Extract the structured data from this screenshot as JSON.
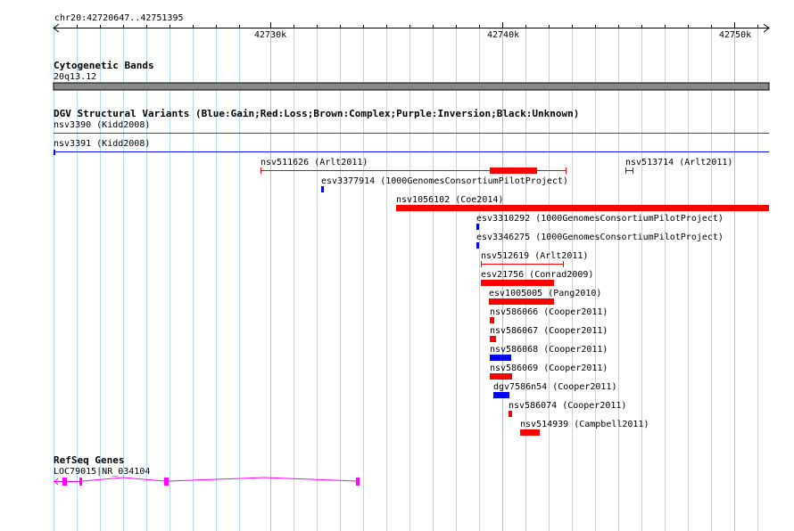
{
  "ruler": {
    "location": "chr20:42720647..42751395",
    "ticks": [
      "42730k",
      "42740k",
      "42750k"
    ]
  },
  "cytoband": {
    "title": "Cytogenetic Bands",
    "band": "20q13.12"
  },
  "dgv": {
    "title": "DGV Structural Variants (Blue:Gain;Red:Loss;Brown:Complex;Purple:Inversion;Black:Unknown)",
    "colors": {
      "gain": "#0000ff",
      "loss": "#ff0000",
      "inversion": "#800080"
    },
    "features": [
      {
        "id": "nsv3390",
        "label": "nsv3390 (Kidd2008)"
      },
      {
        "id": "nsv3391",
        "label": "nsv3391 (Kidd2008)"
      },
      {
        "id": "nsv511626",
        "label": "nsv511626 (Arlt2011)"
      },
      {
        "id": "nsv513714",
        "label": "nsv513714 (Arlt2011)"
      },
      {
        "id": "esv3377914",
        "label": "esv3377914 (1000GenomesConsortiumPilotProject)"
      },
      {
        "id": "nsv1056102",
        "label": "nsv1056102 (Coe2014)"
      },
      {
        "id": "esv3310292",
        "label": "esv3310292 (1000GenomesConsortiumPilotProject)"
      },
      {
        "id": "esv3346275",
        "label": "esv3346275 (1000GenomesConsortiumPilotProject)"
      },
      {
        "id": "nsv512619",
        "label": "nsv512619 (Arlt2011)"
      },
      {
        "id": "esv21756",
        "label": "esv21756 (Conrad2009)"
      },
      {
        "id": "esv1005005",
        "label": "esv1005005 (Pang2010)"
      },
      {
        "id": "nsv586066",
        "label": "nsv586066 (Cooper2011)"
      },
      {
        "id": "nsv586067",
        "label": "nsv586067 (Cooper2011)"
      },
      {
        "id": "nsv586068",
        "label": "nsv586068 (Cooper2011)"
      },
      {
        "id": "nsv586069",
        "label": "nsv586069 (Cooper2011)"
      },
      {
        "id": "dgv7586n54",
        "label": "dgv7586n54 (Cooper2011)"
      },
      {
        "id": "nsv586074",
        "label": "nsv586074 (Cooper2011)"
      },
      {
        "id": "nsv514939",
        "label": "nsv514939 (Campbell2011)"
      }
    ]
  },
  "refseq": {
    "title": "RefSeq Genes",
    "gene_label": "LOC79015|NR_034104",
    "color": "#ff00ff"
  }
}
